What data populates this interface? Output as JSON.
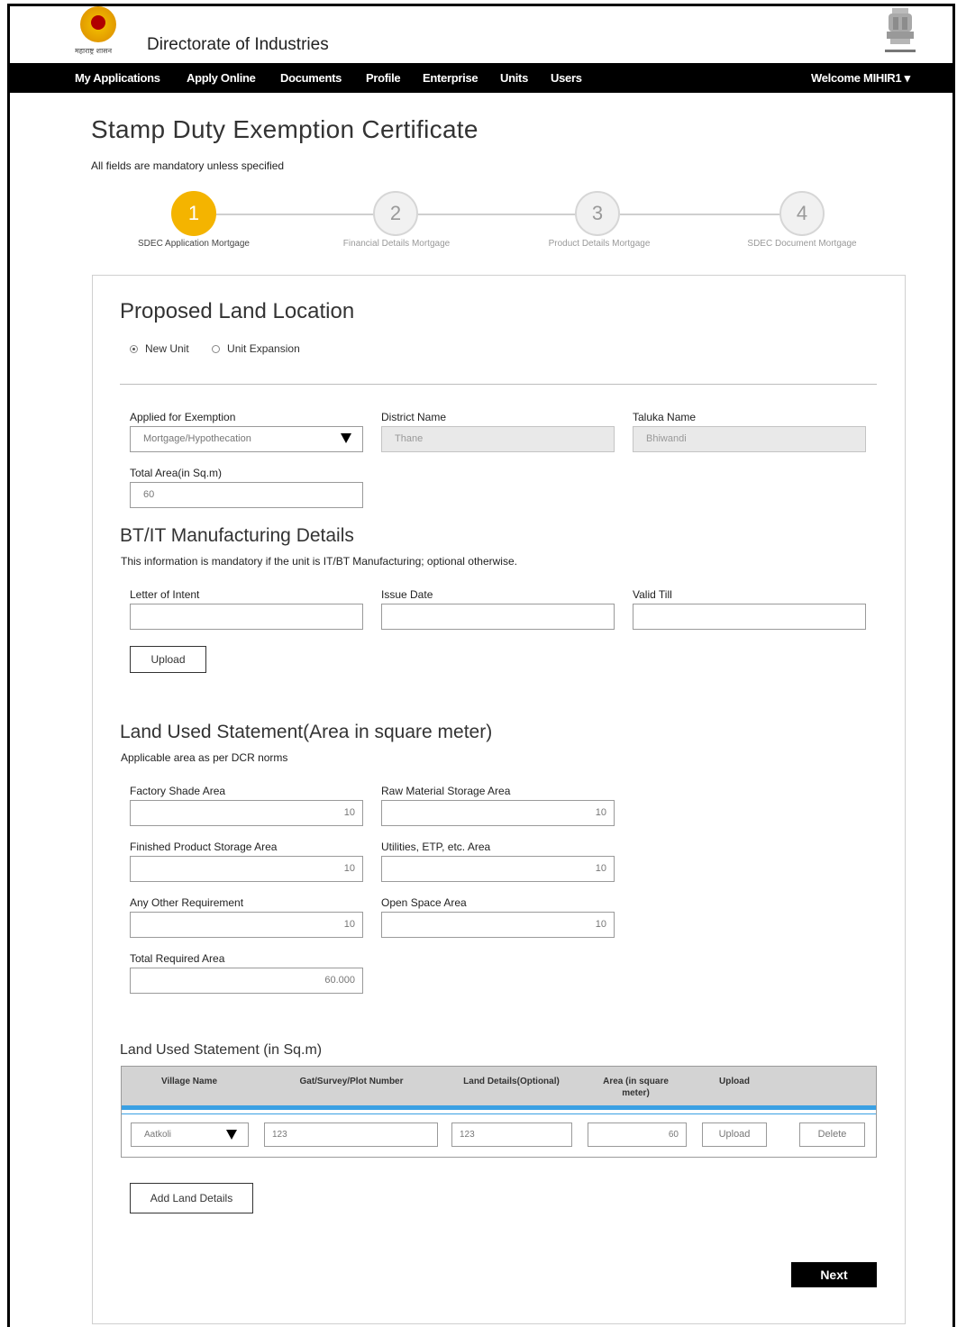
{
  "header": {
    "emblem_left_caption": "महाराष्ट्र शासन",
    "site_title": "Directorate of Industries"
  },
  "nav": {
    "items": [
      "My Applications",
      "Apply Online",
      "Documents",
      "Profile",
      "Enterprise",
      "Units",
      "Users"
    ],
    "welcome": "Welcome MIHIR1 ▾"
  },
  "page": {
    "title": "Stamp Duty Exemption Certificate",
    "mandatory_note": "All fields are mandatory unless specified"
  },
  "stepper": {
    "steps": [
      {
        "number": "1",
        "label": "SDEC Application Mortgage",
        "active": true
      },
      {
        "number": "2",
        "label": "Financial Details Mortgage",
        "active": false
      },
      {
        "number": "3",
        "label": "Product Details Mortgage",
        "active": false
      },
      {
        "number": "4",
        "label": "SDEC Document Mortgage",
        "active": false
      }
    ]
  },
  "location": {
    "title": "Proposed Land Location",
    "radio_new_unit": "New Unit",
    "radio_unit_expansion": "Unit Expansion",
    "selected": "New Unit",
    "applied_for_label": "Applied for Exemption",
    "applied_for_value": "Mortgage/Hypothecation",
    "district_label": "District Name",
    "district_value": "Thane",
    "taluka_label": "Taluka Name",
    "taluka_value": "Bhiwandi",
    "total_area_label": "Total Area(in Sq.m)",
    "total_area_value": "60"
  },
  "btit": {
    "title": "BT/IT Manufacturing Details",
    "note": "This information is mandatory if the unit is IT/BT Manufacturing; optional otherwise.",
    "letter_label": "Letter of Intent",
    "issue_label": "Issue Date",
    "valid_label": "Valid Till",
    "letter_value": "",
    "issue_value": "",
    "valid_value": "",
    "upload_label": "Upload"
  },
  "land_used": {
    "title": "Land Used Statement(Area in square meter)",
    "note": "Applicable area as per DCR norms",
    "factory_label": "Factory Shade Area",
    "factory_value": "10",
    "raw_label": "Raw Material Storage Area",
    "raw_value": "10",
    "finished_label": "Finished Product Storage Area",
    "finished_value": "10",
    "utilities_label": "Utilities, ETP, etc. Area",
    "utilities_value": "10",
    "other_label": "Any Other Requirement",
    "other_value": "10",
    "open_label": "Open Space Area",
    "open_value": "10",
    "total_label": "Total Required Area",
    "total_value": "60.000"
  },
  "land_table": {
    "title": "Land Used Statement (in Sq.m)",
    "headers": {
      "village": "Village Name",
      "gat": "Gat/Survey/Plot Number",
      "land_details": "Land Details(Optional)",
      "area": "Area (in square meter)",
      "upload": "Upload"
    },
    "row": {
      "village": "Aatkoli",
      "gat": "123",
      "land_details": "123",
      "area": "60",
      "upload_button": "Upload",
      "delete_button": "Delete"
    },
    "add_button": "Add Land Details"
  },
  "footer": {
    "next_button": "Next"
  },
  "colors": {
    "accent": "#f4b400",
    "navbar": "#000000",
    "table_rule": "#3aa0e3"
  }
}
